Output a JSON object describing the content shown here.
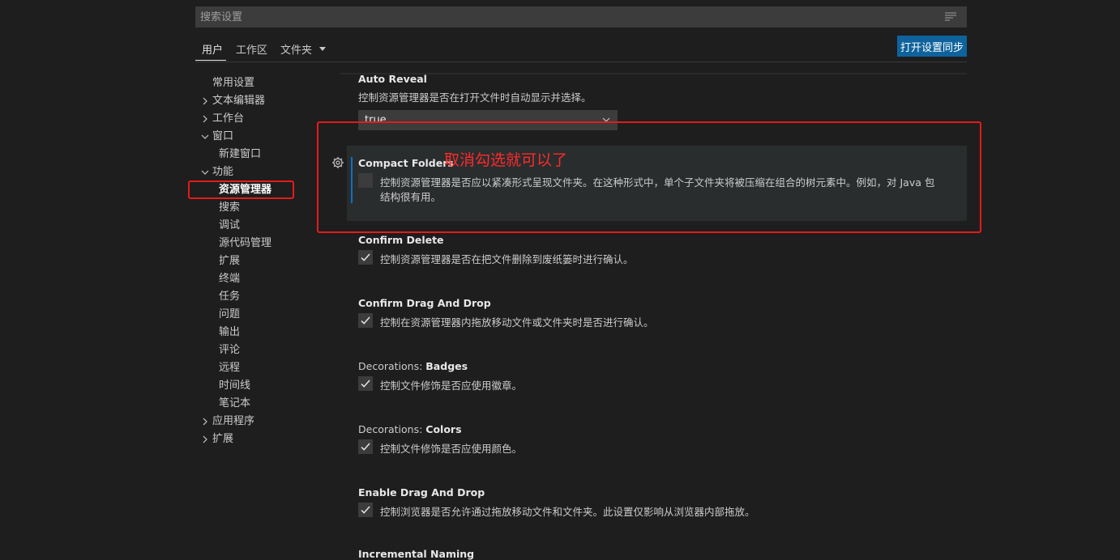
{
  "search": {
    "placeholder": "搜索设置"
  },
  "tabs": [
    {
      "label": "用户"
    },
    {
      "label": "工作区"
    },
    {
      "label": "文件夹"
    }
  ],
  "sync_button": "打开设置同步",
  "toc": {
    "items": [
      {
        "label": "常用设置"
      },
      {
        "label": "文本编辑器"
      },
      {
        "label": "工作台"
      },
      {
        "label": "窗口"
      },
      {
        "label": "新建窗口"
      },
      {
        "label": "功能"
      },
      {
        "label": "资源管理器"
      },
      {
        "label": "搜索"
      },
      {
        "label": "调试"
      },
      {
        "label": "源代码管理"
      },
      {
        "label": "扩展"
      },
      {
        "label": "终端"
      },
      {
        "label": "任务"
      },
      {
        "label": "问题"
      },
      {
        "label": "输出"
      },
      {
        "label": "评论"
      },
      {
        "label": "远程"
      },
      {
        "label": "时间线"
      },
      {
        "label": "笔记本"
      },
      {
        "label": "应用程序"
      },
      {
        "label": "扩展"
      }
    ]
  },
  "settings": {
    "auto_reveal": {
      "title": "Auto Reveal",
      "description": "控制资源管理器是否在打开文件时自动显示并选择。",
      "value": "true"
    },
    "compact_folders": {
      "title": "Compact Folders",
      "description_line1": "控制资源管理器是否应以紧凑形式呈现文件夹。在这种形式中，单个子文件夹将被压缩在组合的树元素中。例如，对 Java 包",
      "description_line2": "结构很有用。",
      "checked": false
    },
    "confirm_delete": {
      "title": "Confirm Delete",
      "description": "控制资源管理器是否在把文件删除到废纸篓时进行确认。",
      "checked": true
    },
    "confirm_drag_drop": {
      "title": "Confirm Drag And Drop",
      "description": "控制在资源管理器内拖放移动文件或文件夹时是否进行确认。",
      "checked": true
    },
    "decorations_badges": {
      "category": "Decorations: ",
      "title": "Badges",
      "description": "控制文件修饰是否应使用徽章。",
      "checked": true
    },
    "decorations_colors": {
      "category": "Decorations: ",
      "title": "Colors",
      "description": "控制文件修饰是否应使用颜色。",
      "checked": true
    },
    "enable_drag_drop": {
      "title": "Enable Drag And Drop",
      "description": "控制浏览器是否允许通过拖放移动文件和文件夹。此设置仅影响从浏览器内部拖放。",
      "checked": true
    },
    "incremental_naming": {
      "title": "Incremental Naming"
    }
  },
  "annotation": {
    "text": "取消勾选就可以了",
    "color": "#e51a1a"
  },
  "colors": {
    "background": "#1e1e1e",
    "accent": "#0e639c",
    "focus_bar": "#0e70c0"
  }
}
